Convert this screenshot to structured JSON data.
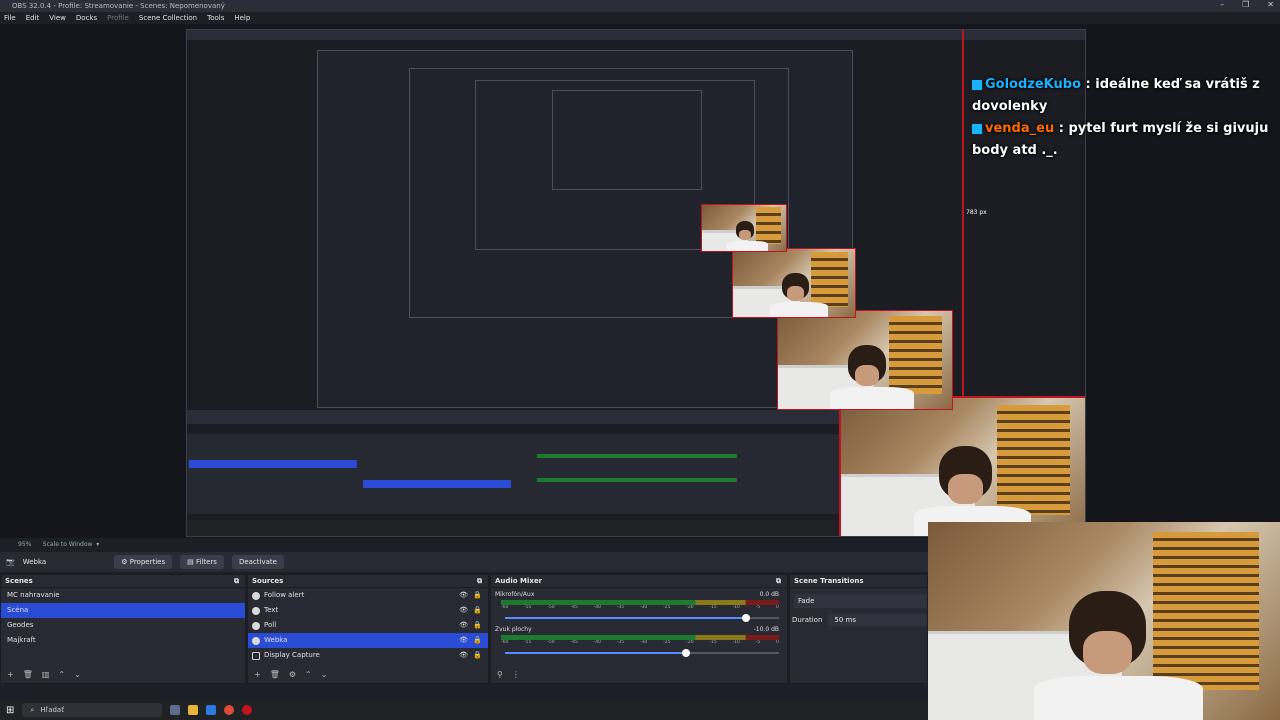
{
  "window": {
    "title": "OBS 32.0.4 - Profile: Streamovanie - Scenes: Nepomenovaný",
    "controls": [
      "–",
      "❐",
      "✕"
    ]
  },
  "menu": [
    "File",
    "Edit",
    "View",
    "Docks",
    "Profile",
    "Scene Collection",
    "Tools",
    "Help"
  ],
  "chat": {
    "messages": [
      {
        "user": "GolodzeKubo",
        "text": ": ideálne keď sa vrátiš z dovolenky"
      },
      {
        "user": "venda_eu",
        "text": ": pytel furt myslí že si givuju body atd ._."
      }
    ],
    "dimension_label": "783 px"
  },
  "preview_context": {
    "zoom": "95%",
    "scale_mode": "Scale to Window"
  },
  "source_toolbar": {
    "selected_source": "Webka",
    "properties_label": "Properties",
    "filters_label": "Filters",
    "deactivate_label": "Deactivate"
  },
  "scenes": {
    "title": "Scenes",
    "items": [
      "MC nahravanie",
      "Scéna",
      "Geodes",
      "Majkraft"
    ],
    "selected": 1
  },
  "sources": {
    "title": "Sources",
    "items": [
      "Follow alert",
      "Text",
      "Poll",
      "Webka",
      "Display Capture"
    ],
    "selected": 3
  },
  "audio_mixer": {
    "title": "Audio Mixer",
    "channels": [
      {
        "name": "Mikrofón/Aux",
        "db": "0.0 dB",
        "level": 0.88
      },
      {
        "name": "Zvuk plochy",
        "db": "-10.0 dB",
        "level": 0.66
      }
    ],
    "ticks": [
      "-60",
      "-55",
      "-50",
      "-45",
      "-40",
      "-35",
      "-30",
      "-25",
      "-20",
      "-15",
      "-10",
      "-5",
      "0"
    ]
  },
  "scene_transitions": {
    "title": "Scene Transitions",
    "transition": "Fade",
    "duration_label": "Duration",
    "duration_value": "50 ms"
  },
  "taskbar": {
    "search_placeholder": "Hľadať"
  },
  "colors": {
    "selection": "#2a4bd4",
    "webcam_border": "#c0141e",
    "chat_user1": "#1ab3ff",
    "chat_user2": "#ff6a00"
  }
}
